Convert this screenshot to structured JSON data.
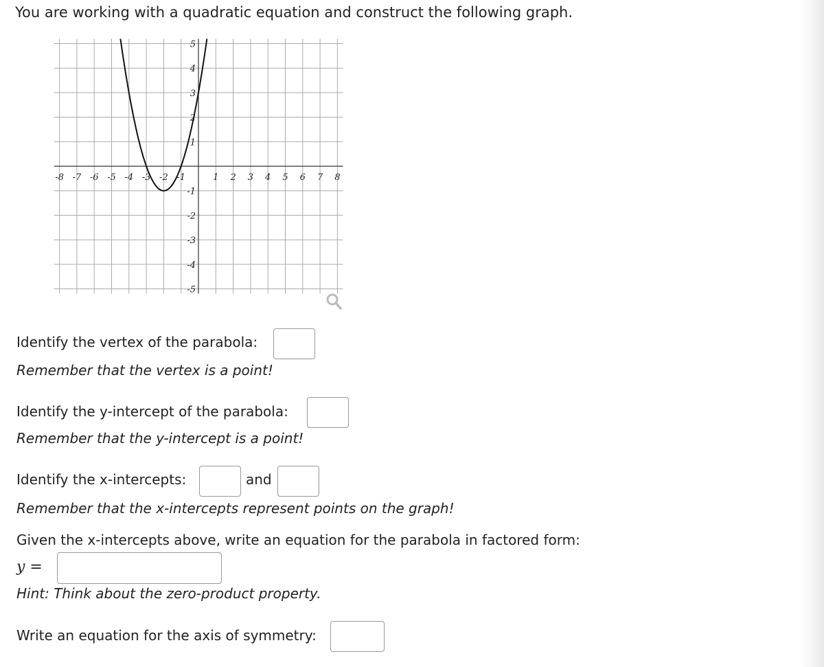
{
  "question": {
    "intro": "You are working with a quadratic equation and construct the following graph.",
    "vertex_prompt": "Identify the vertex of the parabola:",
    "vertex_hint": "Remember that the vertex is a point!",
    "yint_prompt": "Identify the y-intercept of the parabola:",
    "yint_hint": "Remember that the y-intercept is a point!",
    "xint_prompt": "Identify the x-intercepts:",
    "xint_and": "and",
    "xint_hint": "Remember that the x-intercepts represent points on the graph!",
    "factored_prompt": "Given the x-intercepts above, write an equation for the parabola in factored form:",
    "y_equals": "y =",
    "factored_hint": "Hint: Think about the zero-product property.",
    "axis_prompt": "Write an equation for the axis of symmetry:"
  },
  "inputs": {
    "vertex": "",
    "y_intercept": "",
    "x_intercept_1": "",
    "x_intercept_2": "",
    "factored_form": "",
    "axis_of_symmetry": ""
  },
  "graph": {
    "zoom_icon": "magnifier-icon"
  },
  "chart_data": {
    "type": "line",
    "xlim": [
      -8,
      8
    ],
    "ylim": [
      -5,
      5
    ],
    "grid": true,
    "x_ticks": [
      "-8",
      "-7",
      "-6",
      "-5",
      "-4",
      "-3",
      "-2",
      "-1",
      "1",
      "2",
      "3",
      "4",
      "5",
      "6",
      "7",
      "8"
    ],
    "y_ticks": [
      "5",
      "4",
      "3",
      "2",
      "1",
      "-1",
      "-2",
      "-3",
      "-4",
      "-5"
    ],
    "series": [
      {
        "function": "y = x^2 + 4x + 3",
        "x": [
          -4.5,
          -4,
          -3.5,
          -3,
          -2.5,
          -2,
          -1.5,
          -1,
          -0.5,
          0,
          0.5
        ],
        "y": [
          5.25,
          3,
          1.25,
          0,
          -0.75,
          -1,
          -0.75,
          0,
          1.25,
          3,
          5.25
        ],
        "color": "#111111"
      }
    ]
  }
}
